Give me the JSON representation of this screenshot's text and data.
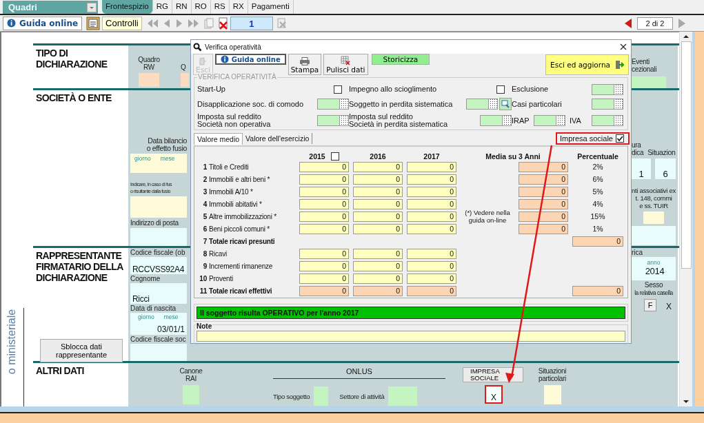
{
  "topbar": {
    "quadri": "Quadri",
    "tabs": [
      {
        "label": "Frontespizio",
        "selected": true
      },
      {
        "label": "RG",
        "selected": false
      },
      {
        "label": "RN",
        "selected": false
      },
      {
        "label": "RO",
        "selected": false
      },
      {
        "label": "RS",
        "selected": false
      },
      {
        "label": "RX",
        "selected": false
      },
      {
        "label": "Pagamenti",
        "selected": false
      }
    ]
  },
  "nav": {
    "guida": "Guida online",
    "controlli": "Controlli",
    "page": "1",
    "page_count": "2 di 2"
  },
  "form": {
    "side_label": "o ministeriale",
    "tipo": {
      "title": "TIPO DI DICHIARAZIONE",
      "quadro_rw": "Quadro RW",
      "quadro_cut": "Q",
      "eventi": [
        "Eventi",
        "cezionali"
      ]
    },
    "societa": {
      "title": "SOCIETÀ O ENTE",
      "data_bilancio": [
        "Data bilancio",
        "o effetto fusio"
      ],
      "date_parts": [
        "giorno",
        "mese"
      ],
      "indicare": [
        "Indicare, in caso di fus",
        "o risultante dalla fusio"
      ],
      "posta": "Indirizzo di posta",
      "natura": [
        "ura",
        "dica"
      ],
      "situazione": "Situazion",
      "natura_value": "1",
      "situazione_value": "6",
      "enti": [
        "nti associativi ex",
        "t. 148, commi",
        "e ss. TUIR"
      ]
    },
    "rappresentante": {
      "title": "RAPPRESENTANTE FIRMATARIO DELLA DICHIARAZIONE",
      "cf_label": "Codice fiscale (ob",
      "cf_value": "RCCVSS92A4",
      "cognome_label": "Cognome",
      "cognome_value": "Ricci",
      "nascita_label": "Data di nascita",
      "date_parts": [
        "giorno",
        "mese"
      ],
      "nascita_value": "03/01/1",
      "cf_soc_label": "Codice fiscale soc",
      "carica": "rica",
      "anno": "anno",
      "anno_value": "2014",
      "sesso": "Sesso",
      "sesso_hint": "la relativa casella",
      "sesso_f": "F",
      "sesso_x": "X",
      "unlock_button": "Sblocca dati rappresentante"
    },
    "altri": {
      "title": "ALTRI DATI",
      "canone": "Canone RAI",
      "onlus": "ONLUS",
      "tipo_soggetto": "Tipo soggetto",
      "settore": "Settore di attività",
      "impresa_button": "IMPRESA SOCIALE",
      "impresa_value": "X",
      "situazioni": "Situazioni particolari"
    }
  },
  "dialog": {
    "title": "Verifica operatività",
    "toolbar": [
      {
        "kind": "exit",
        "label": "Esci",
        "disabled": true
      },
      {
        "kind": "help",
        "label": "Guida online",
        "disabled": false
      },
      {
        "kind": "print",
        "label": "Stampa",
        "disabled": false
      },
      {
        "kind": "clear",
        "label": "Pulisci dati",
        "disabled": false
      },
      {
        "kind": "archive",
        "label": "Storicizza",
        "disabled": false
      }
    ],
    "exit_update": "Esci ed aggiorna",
    "group": {
      "title": "VERIFICA OPERATIVITÀ",
      "rows": [
        [
          [
            {
              "kind": "checkbox",
              "label": "Start-Up",
              "checked": false
            }
          ],
          [
            {
              "kind": "checkbox",
              "label": "Impegno allo scioglimento",
              "checked": false
            }
          ],
          [
            {
              "kind": "picker",
              "label": "Esclusione",
              "lookup": false
            }
          ]
        ],
        [
          [
            {
              "kind": "picker",
              "label": "Disapplicazione soc. di comodo",
              "lookup": false
            }
          ],
          [
            {
              "kind": "picker",
              "label": "Soggetto in perdita sistematica",
              "lookup": true
            }
          ],
          [
            {
              "kind": "picker",
              "label": "Casi particolari",
              "lookup": false
            }
          ]
        ],
        [
          [
            {
              "kind": "picker",
              "label": "Imposta sul reddito\nSocietà non operativa",
              "lookup": false
            }
          ],
          [
            {
              "kind": "picker",
              "label": "Imposta sul reddito\nSocietà in perdita sistematica",
              "lookup": false
            }
          ],
          [
            {
              "kind": "picker",
              "label": "IRAP",
              "lookup": false
            },
            {
              "kind": "picker",
              "label": "IVA",
              "lookup": false
            }
          ]
        ]
      ]
    },
    "tabs": [
      {
        "label": "Valore medio",
        "selected": true
      },
      {
        "label": "Valore dell'esercizio",
        "selected": false
      }
    ],
    "impresa_sociale": {
      "label": "Impresa sociale",
      "checked": true
    },
    "table": {
      "years": [
        {
          "label": "2015",
          "kind": "checkbox",
          "checked": false
        },
        {
          "label": "2016",
          "kind": "plain"
        },
        {
          "label": "2017",
          "kind": "plain"
        }
      ],
      "media_header": "Media su 3 Anni",
      "pct_header": "Percentuale",
      "note": "(*) Vedere nella guida on-line",
      "rows": [
        {
          "num": "1",
          "label": "Titoli e Crediti",
          "kind": "input",
          "values": [
            "0",
            "0",
            "0"
          ],
          "media": "0",
          "pct": "2%"
        },
        {
          "num": "2",
          "label": "Immobili e altri beni *",
          "kind": "input",
          "values": [
            "0",
            "0",
            "0"
          ],
          "media": "0",
          "pct": "6%"
        },
        {
          "num": "3",
          "label": "Immobili A/10 *",
          "kind": "input",
          "values": [
            "0",
            "0",
            "0"
          ],
          "media": "0",
          "pct": "5%"
        },
        {
          "num": "4",
          "label": "Immobili abitativi *",
          "kind": "input",
          "values": [
            "0",
            "0",
            "0"
          ],
          "media": "0",
          "pct": "4%"
        },
        {
          "num": "5",
          "label": "Altre immobilizzazioni *",
          "kind": "input",
          "values": [
            "0",
            "0",
            "0"
          ],
          "media": "0",
          "pct": "15%"
        },
        {
          "num": "6",
          "label": "Beni piccoli comuni *",
          "kind": "input",
          "values": [
            "0",
            "0",
            "0"
          ],
          "media": "0",
          "pct": "1%"
        },
        {
          "num": "7",
          "label": "Totale ricavi presunti",
          "kind": "summary",
          "total": "0"
        },
        {
          "num": "8",
          "label": "Ricavi",
          "kind": "plain",
          "values": [
            "0",
            "0",
            "0"
          ]
        },
        {
          "num": "9",
          "label": "Incrementi rimanenze",
          "kind": "plain",
          "values": [
            "0",
            "0",
            "0"
          ]
        },
        {
          "num": "10",
          "label": "Proventi",
          "kind": "plain",
          "values": [
            "0",
            "0",
            "0"
          ]
        },
        {
          "num": "11",
          "label": "Totale ricavi effettivi",
          "kind": "total",
          "values": [
            "0",
            "0",
            "0"
          ],
          "total": "0"
        }
      ]
    },
    "status": {
      "text": "Il soggetto risulta OPERATIVO per l'anno 2017",
      "ok": true
    },
    "note_label": "Note"
  }
}
